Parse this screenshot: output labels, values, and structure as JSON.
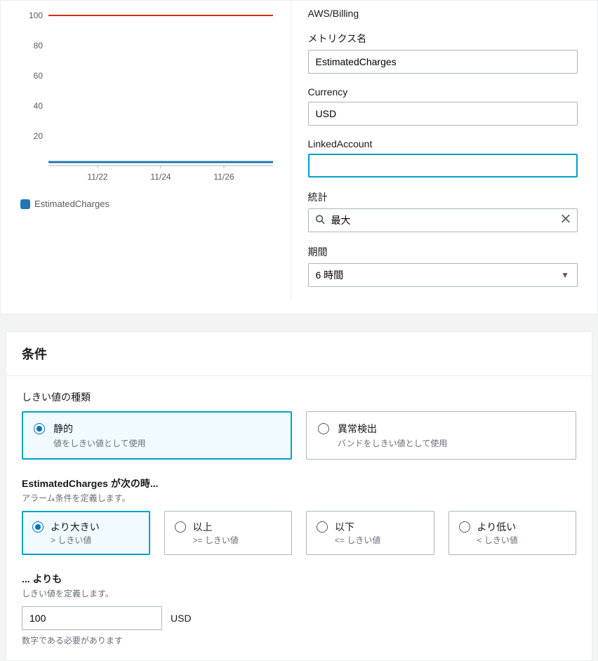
{
  "chart_data": {
    "type": "line",
    "series": [
      {
        "name": "EstimatedCharges",
        "values": [
          2,
          2,
          2,
          2,
          2,
          2,
          2
        ],
        "color": "#1f77b4"
      },
      {
        "name": "Threshold",
        "values": [
          100,
          100,
          100,
          100,
          100,
          100,
          100
        ],
        "color": "#d13212"
      }
    ],
    "x_ticks": [
      "11/22",
      "11/24",
      "11/26"
    ],
    "y_ticks": [
      20,
      40,
      60,
      80,
      100
    ],
    "ylim": [
      0,
      105
    ],
    "legend": [
      "EstimatedCharges"
    ]
  },
  "meta": {
    "namespace": "AWS/Billing",
    "metric_name_label": "メトリクス名",
    "metric_name_value": "EstimatedCharges",
    "currency_label": "Currency",
    "currency_value": "USD",
    "linked_account_label": "LinkedAccount",
    "linked_account_value": "",
    "stat_label": "統計",
    "stat_value": "最大",
    "period_label": "期間",
    "period_value": "6 時間"
  },
  "conditions": {
    "panel_title": "条件",
    "threshold_type_label": "しきい値の種類",
    "type_static_title": "静的",
    "type_static_desc": "値をしきい値として使用",
    "type_anomaly_title": "異常検出",
    "type_anomaly_desc": "バンドをしきい値として使用",
    "when_label": "EstimatedCharges が次の時...",
    "when_hint": "アラーム条件を定義します。",
    "op_gt_title": "より大きい",
    "op_gt_desc": "> しきい値",
    "op_gte_title": "以上",
    "op_gte_desc": ">= しきい値",
    "op_lte_title": "以下",
    "op_lte_desc": "<= しきい値",
    "op_lt_title": "より低い",
    "op_lt_desc": "< しきい値",
    "than_label": "... よりも",
    "than_hint": "しきい値を定義します。",
    "threshold_value": "100",
    "threshold_unit": "USD",
    "numeric_hint": "数字である必要があります"
  }
}
